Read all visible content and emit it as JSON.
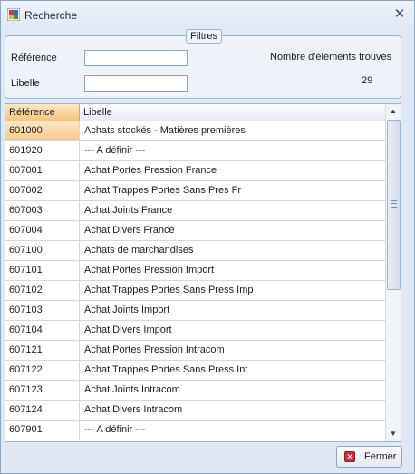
{
  "window": {
    "title": "Recherche",
    "app_icon": "app-grid-icon",
    "close_icon": "close-icon",
    "close_glyph": "✕"
  },
  "filters": {
    "legend": "Filtres",
    "reference_label": "Référence",
    "reference_value": "",
    "libelle_label": "Libelle",
    "libelle_value": "",
    "count_label": "Nombre d'éléments trouvés",
    "count_value": "29"
  },
  "grid": {
    "columns": [
      "Référence",
      "Libelle"
    ],
    "rows": [
      {
        "ref": "601000",
        "lib": "Achats stockés - Matières premières"
      },
      {
        "ref": "601920",
        "lib": "--- A définir ---"
      },
      {
        "ref": "607001",
        "lib": "Achat Portes Pression France"
      },
      {
        "ref": "607002",
        "lib": "Achat Trappes Portes Sans Pres Fr"
      },
      {
        "ref": "607003",
        "lib": "Achat Joints France"
      },
      {
        "ref": "607004",
        "lib": "Achat Divers France"
      },
      {
        "ref": "607100",
        "lib": "Achats de marchandises"
      },
      {
        "ref": "607101",
        "lib": "Achat Portes Pression Import"
      },
      {
        "ref": "607102",
        "lib": "Achat Trappes Portes Sans Press Imp"
      },
      {
        "ref": "607103",
        "lib": "Achat Joints Import"
      },
      {
        "ref": "607104",
        "lib": "Achat Divers Import"
      },
      {
        "ref": "607121",
        "lib": "Achat Portes Pression Intracom"
      },
      {
        "ref": "607122",
        "lib": "Achat Trappes Portes Sans Press Int"
      },
      {
        "ref": "607123",
        "lib": "Achat Joints Intracom"
      },
      {
        "ref": "607124",
        "lib": "Achat Divers Intracom"
      },
      {
        "ref": "607901",
        "lib": "--- A définir ---"
      }
    ],
    "selected_index": 0
  },
  "scrollbar": {
    "up_glyph": "▲",
    "down_glyph": "▼"
  },
  "buttons": {
    "fermer_label": "Fermer",
    "fermer_icon_glyph": "✕"
  },
  "colors": {
    "selection": "#f6c37d",
    "frame": "#dfe8f5"
  }
}
